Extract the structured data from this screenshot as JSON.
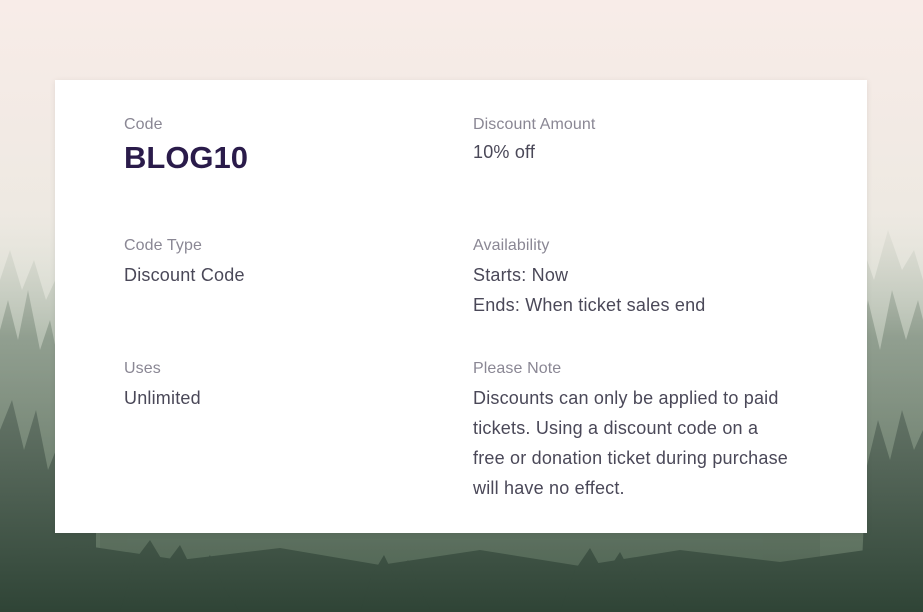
{
  "details": {
    "code": {
      "label": "Code",
      "value": "BLOG10"
    },
    "discount_amount": {
      "label": "Discount Amount",
      "value": "10% off"
    },
    "code_type": {
      "label": "Code Type",
      "value": "Discount Code"
    },
    "availability": {
      "label": "Availability",
      "starts": "Starts: Now",
      "ends": "Ends: When ticket sales end"
    },
    "uses": {
      "label": "Uses",
      "value": "Unlimited"
    },
    "please_note": {
      "label": "Please Note",
      "value": "Discounts can only be applied to paid tickets. Using a discount code on a free or donation ticket during purchase will have no effect."
    }
  }
}
